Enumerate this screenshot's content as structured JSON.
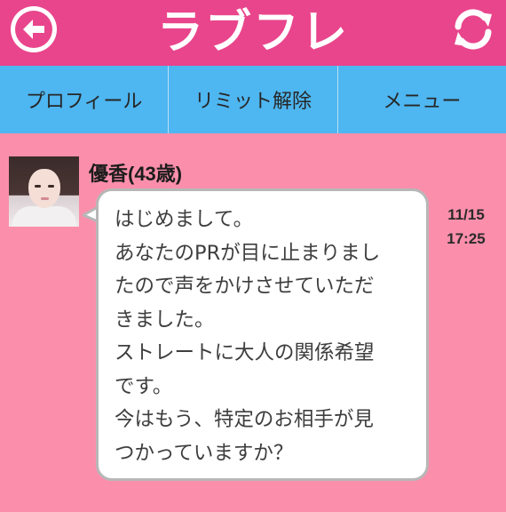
{
  "header": {
    "logo_text": "ラブフレ",
    "back_icon": "arrow-left-icon",
    "refresh_icon": "refresh-icon",
    "colors": {
      "background": "#e9458c",
      "foreground": "#ffffff"
    }
  },
  "nav": {
    "items": [
      {
        "label": "プロフィール"
      },
      {
        "label": "リミット解除"
      },
      {
        "label": "メニュー"
      }
    ],
    "color": "#4eb6f0"
  },
  "message": {
    "sender": "優香(43歳)",
    "text": "はじめまして。\nあなたのPRが目に止まりまし\nたので声をかけさせていただ\nきました。\nストレートに大人の関係希望\nです。\n今はもう、特定のお相手が見\nつかっていますか？",
    "date": "11/15",
    "time": "17:25"
  },
  "background_color": "#fb8fab"
}
